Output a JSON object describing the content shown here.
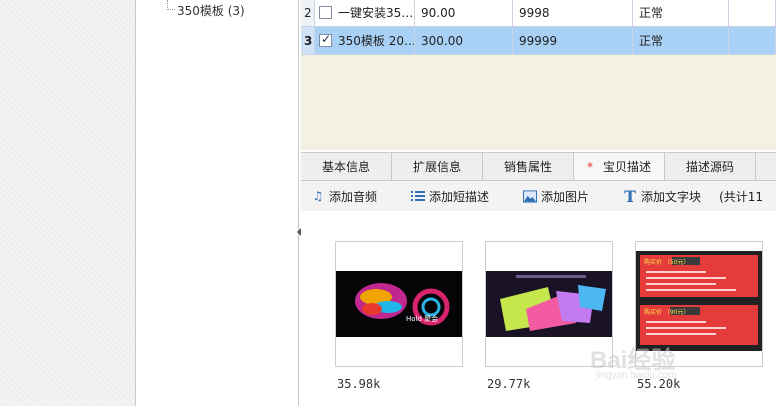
{
  "tree": {
    "node_label": "350模板 (3)"
  },
  "grid": {
    "rows": [
      {
        "idx": "2",
        "checked": false,
        "name": "一键安装35…",
        "price": "90.00",
        "qty": "9998",
        "status": "正常"
      },
      {
        "idx": "3",
        "checked": true,
        "name": "350模板 20…",
        "price": "300.00",
        "qty": "99999",
        "status": "正常"
      }
    ]
  },
  "tabs": [
    {
      "label": "基本信息"
    },
    {
      "label": "扩展信息"
    },
    {
      "label": "销售属性"
    },
    {
      "label": "宝贝描述",
      "marker": "*"
    },
    {
      "label": "描述源码"
    }
  ],
  "toolbar": {
    "add_audio": "添加音频",
    "add_short_desc": "添加短描述",
    "add_image": "添加图片",
    "add_text_block": "添加文字块",
    "total": "(共计11"
  },
  "thumbnails": [
    {
      "size": "35.98k",
      "caption": "Hold 聚会"
    },
    {
      "size": "29.77k"
    },
    {
      "size": "55.20k",
      "label_top": "购买价 （50元）",
      "label_mid": "购买价 （90元）"
    }
  ],
  "watermark": {
    "main": "Bai经验",
    "sub": "jingyan.baidu.com"
  },
  "colors": {
    "selected_row": "#a9d1f5",
    "grid_bg": "#f4f1e3",
    "required_marker": "#dd3333"
  }
}
